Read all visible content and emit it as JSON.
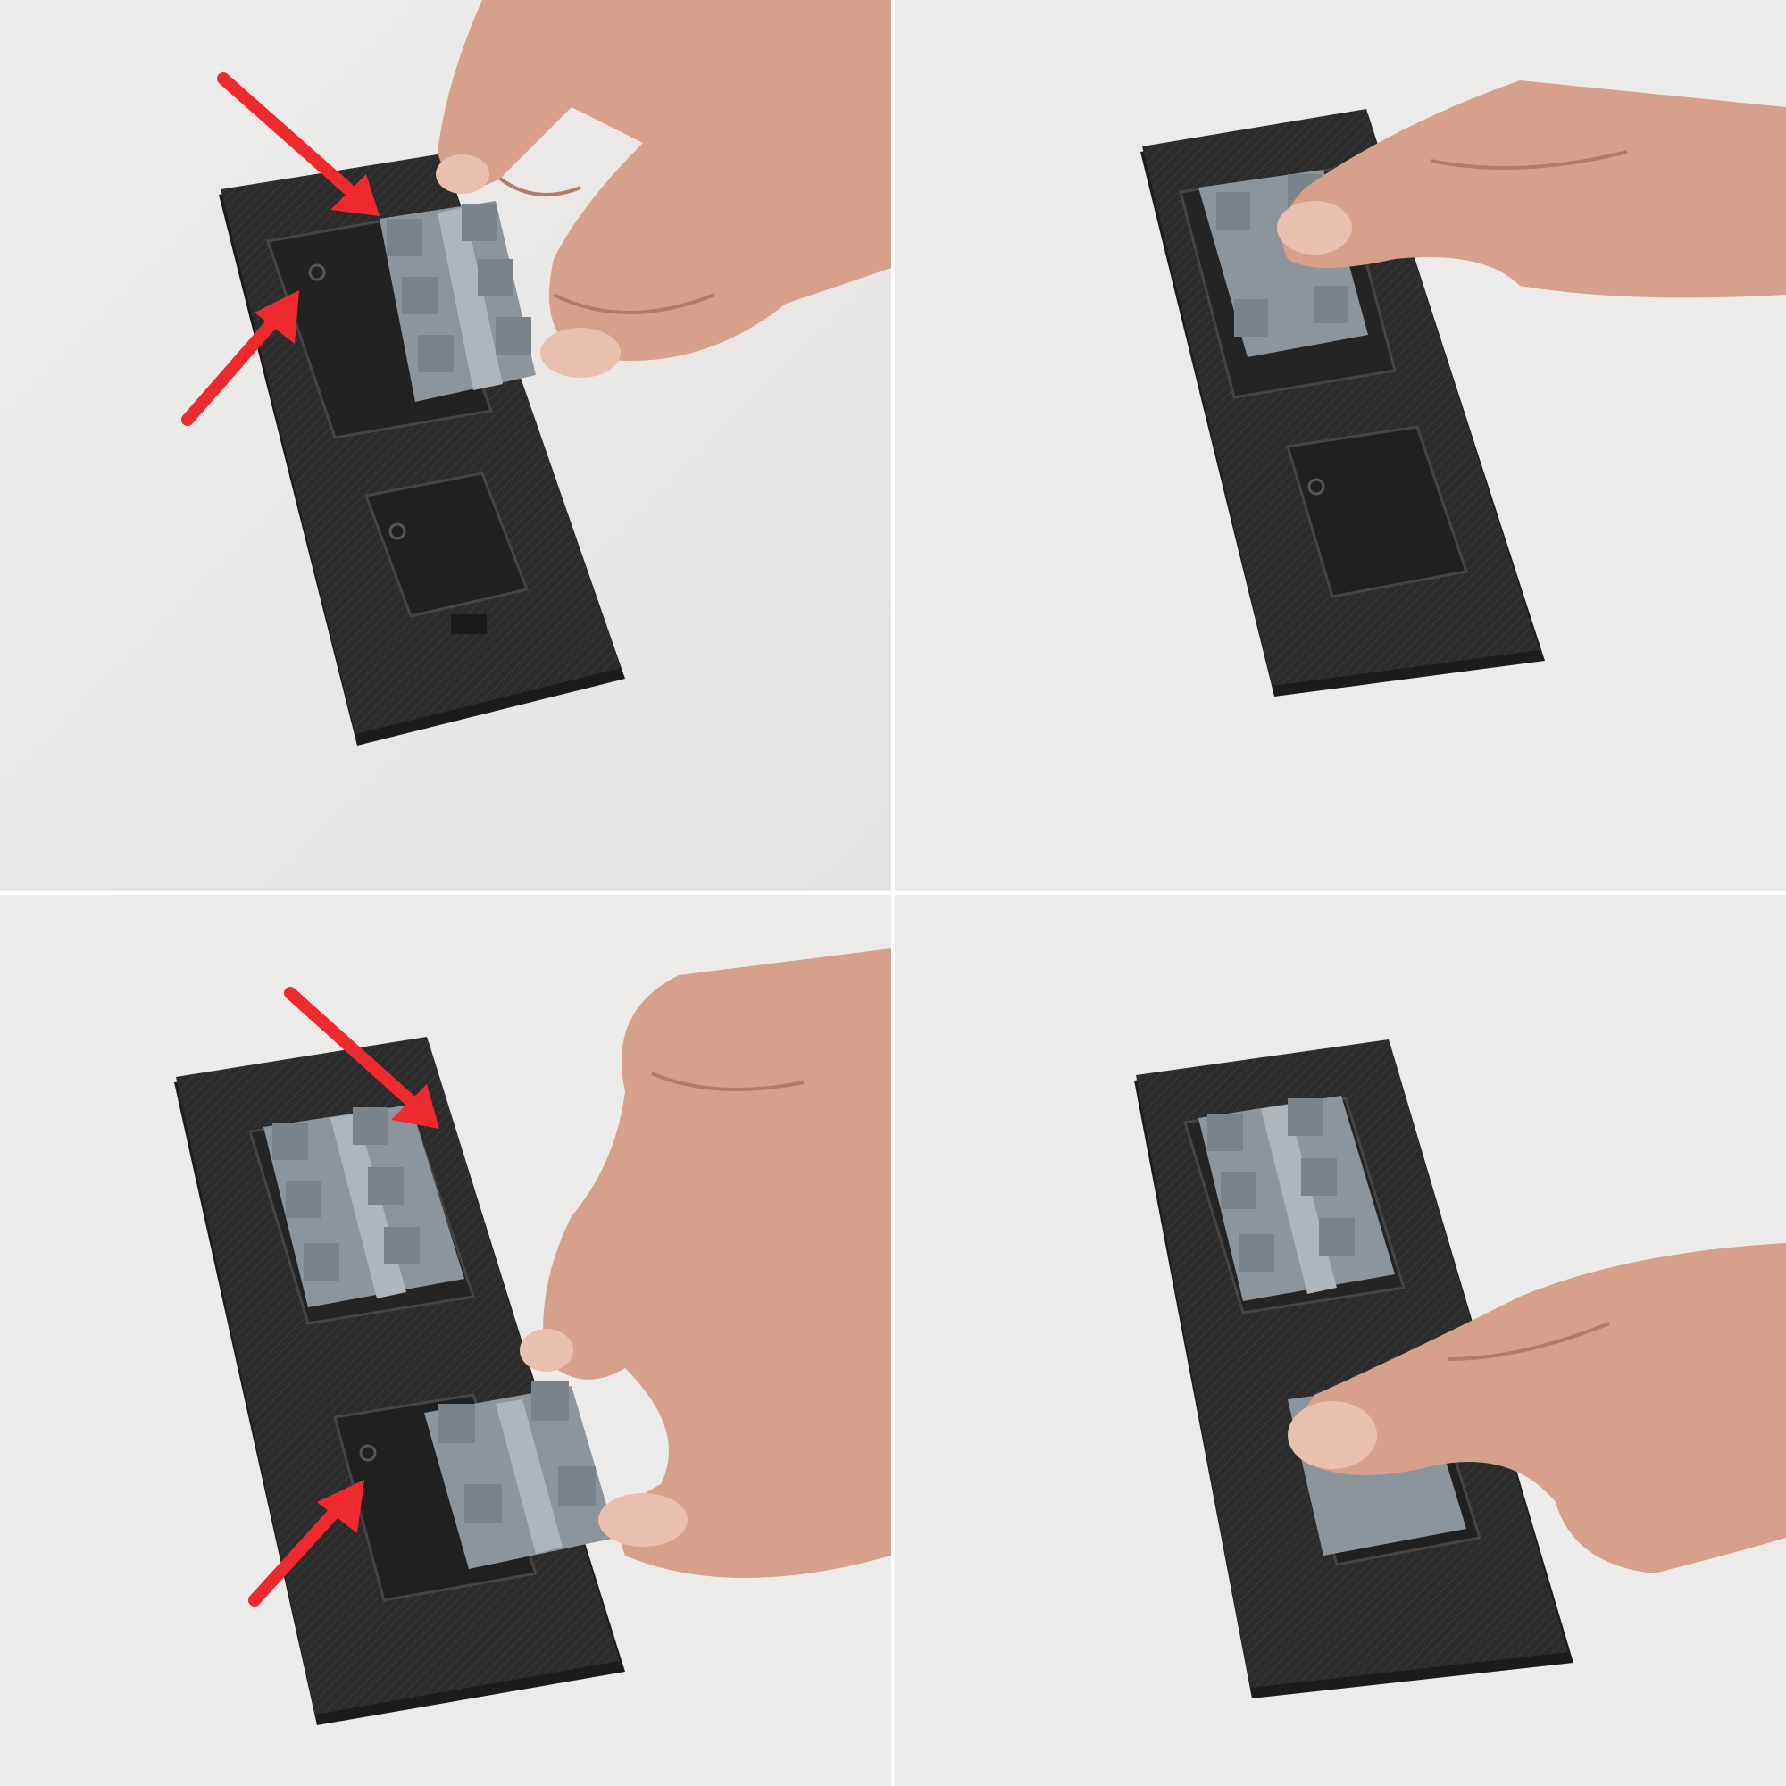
{
  "figure": {
    "panels": [
      {
        "id": "panel-1",
        "description_icon": "place-part-photo",
        "arrows": 2
      },
      {
        "id": "panel-2",
        "description_icon": "press-part-photo",
        "arrows": 0
      },
      {
        "id": "panel-3",
        "description_icon": "place-part-photo",
        "arrows": 2
      },
      {
        "id": "panel-4",
        "description_icon": "press-part-photo",
        "arrows": 0
      }
    ],
    "colors": {
      "background": "#ecebe9",
      "base_plate": "#2a2a2a",
      "part": "#9ea6ae",
      "arrow": "#ee2a2e",
      "skin": "#d9a48c"
    }
  }
}
